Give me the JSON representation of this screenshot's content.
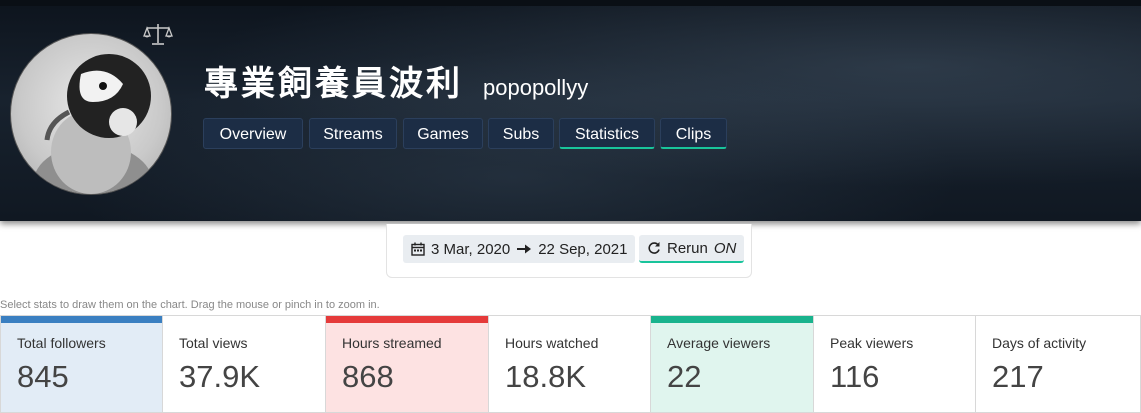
{
  "channel": {
    "display_name": "專業飼養員波利",
    "login": "popopollyy"
  },
  "icons": {
    "avatar": "penguin-avatar",
    "scale": "balance-scale-icon",
    "calendar": "calendar-icon",
    "arrow": "arrow-right-icon",
    "rerun": "rotate-icon"
  },
  "tabs": [
    {
      "label": "Overview",
      "active": false
    },
    {
      "label": "Streams",
      "active": false
    },
    {
      "label": "Games",
      "active": false
    },
    {
      "label": "Subs",
      "active": false
    },
    {
      "label": "Statistics",
      "active": true
    },
    {
      "label": "Clips",
      "active": true
    }
  ],
  "date_filter": {
    "start": "3 Mar, 2020",
    "end": "22 Sep, 2021",
    "rerun_label": "Rerun",
    "rerun_state": "ON"
  },
  "hint": "Select stats to draw them on the chart. Drag the mouse or pinch in to zoom in.",
  "stats": [
    {
      "label": "Total followers",
      "value": "845",
      "selected": true,
      "color": "#3a7fc1",
      "bg": "#e2ecf6"
    },
    {
      "label": "Total views",
      "value": "37.9K",
      "selected": false,
      "color": "",
      "bg": "#ffffff"
    },
    {
      "label": "Hours streamed",
      "value": "868",
      "selected": true,
      "color": "#e53a3a",
      "bg": "#fde2e2"
    },
    {
      "label": "Hours watched",
      "value": "18.8K",
      "selected": false,
      "color": "",
      "bg": "#ffffff"
    },
    {
      "label": "Average viewers",
      "value": "22",
      "selected": true,
      "color": "#19b38d",
      "bg": "#e0f5ee"
    },
    {
      "label": "Peak viewers",
      "value": "116",
      "selected": false,
      "color": "",
      "bg": "#ffffff"
    },
    {
      "label": "Days of activity",
      "value": "217",
      "selected": false,
      "color": "",
      "bg": "#ffffff"
    }
  ],
  "accent": "#19c49b"
}
